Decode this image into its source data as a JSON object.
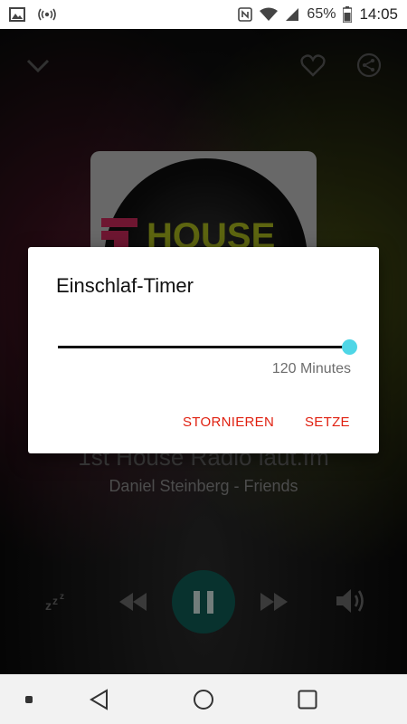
{
  "status_bar": {
    "icons": [
      "image-icon",
      "radio-broadcast-icon",
      "nfc-icon",
      "wifi-icon",
      "signal-icon",
      "battery-icon"
    ],
    "battery": "65%",
    "time": "14:05"
  },
  "player": {
    "cover_text": "HOUSE",
    "track_title": "1st House Radio laut.fm",
    "track_subtitle": "Daniel Steinberg - Friends",
    "play_color": "#0f5c55"
  },
  "dialog": {
    "title": "Einschlaf-Timer",
    "slider_level": 1.0,
    "value_label": "120 Minutes",
    "cancel_label": "STORNIEREN",
    "set_label": "SETZE",
    "accent_color": "#e02010",
    "thumb_color": "#4fd6e6"
  }
}
